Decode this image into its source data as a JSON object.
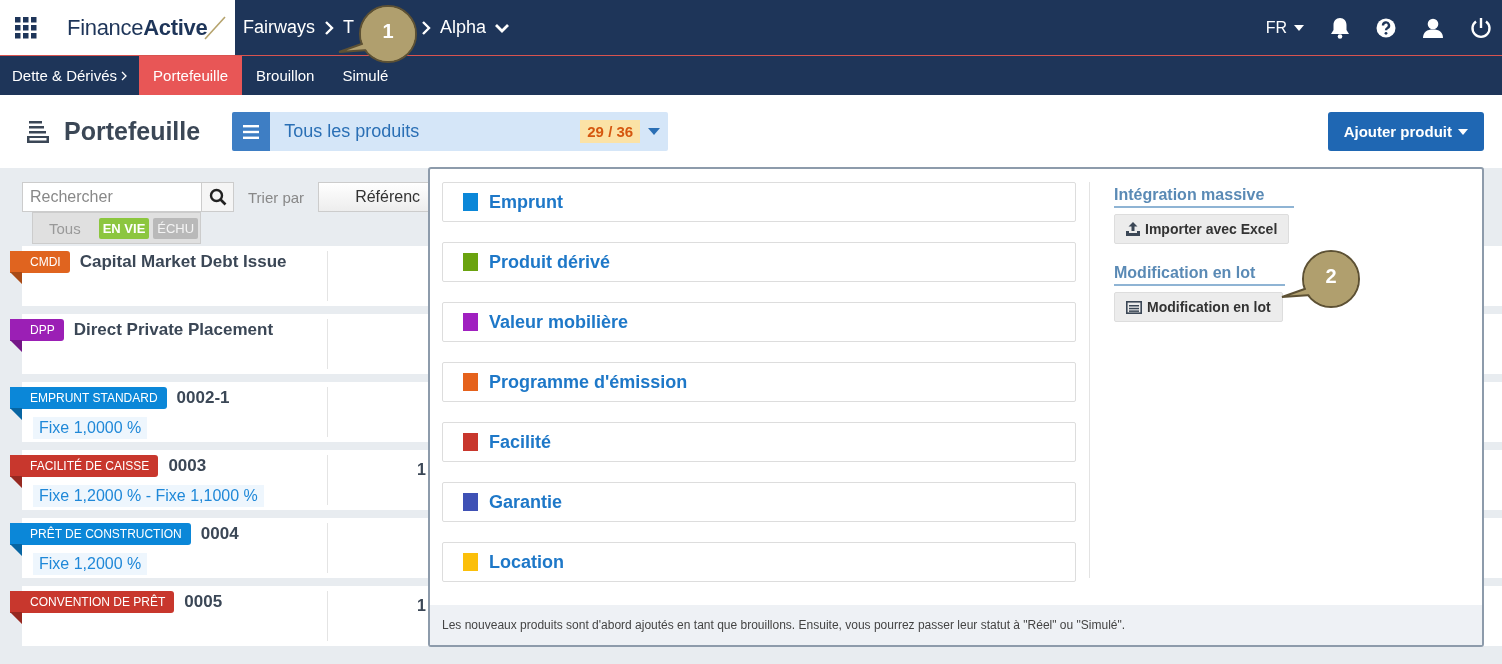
{
  "top_bar": {
    "logo": "Finance**Active**",
    "breadcrumb": [
      {
        "label": "Fairways"
      },
      {
        "label": "T"
      },
      {
        "label": "Alpha"
      }
    ],
    "language": "FR"
  },
  "sub_nav": {
    "section": "Dette & Dérivés",
    "tabs": [
      {
        "label": "Portefeuille",
        "selected": true
      },
      {
        "label": "Brouillon",
        "selected": false
      },
      {
        "label": "Simulé",
        "selected": false
      }
    ]
  },
  "header": {
    "title": "Portefeuille",
    "filter": "Tous les produits",
    "count": "29 / 36",
    "add_button": "Ajouter produit"
  },
  "toolbar": {
    "search": {
      "placeholder": "Rechercher"
    },
    "sort_label": "Trier par",
    "sort_value": "Référenc",
    "status_filter": [
      {
        "label": "Tous",
        "selected": false
      },
      {
        "label": "EN VIE",
        "selected": true,
        "color": "#8cc63f"
      },
      {
        "label": "ÉCHU",
        "selected": false,
        "color": "#b9b9b9"
      }
    ]
  },
  "rows": [
    {
      "tag": "CMDI",
      "color": "#e0641f",
      "title": "Capital Market Debt Issue"
    },
    {
      "tag": "DPP",
      "color": "#9b1fb5",
      "title": "Direct Private Placement"
    },
    {
      "tag": "EMPRUNT STANDARD",
      "color": "#0b87d8",
      "title": "0002-1",
      "rate": "Fixe 1,0000 %"
    },
    {
      "tag": "FACILITÉ DE CAISSE",
      "color": "#c8372d",
      "title": "0003",
      "rate": "Fixe 1,2000 % - Fixe 1,1000 %",
      "column_2": "1"
    },
    {
      "tag": "PRÊT DE CONSTRUCTION",
      "color": "#0b87d8",
      "title": "0004",
      "rate": "Fixe 1,2000 %"
    },
    {
      "tag": "CONVENTION DE PRÊT",
      "color": "#c8372d",
      "title": "0005",
      "column_2": "1"
    }
  ],
  "add_menu": {
    "products": [
      {
        "label": "Emprunt",
        "color": "#0b87d8"
      },
      {
        "label": "Produit dérivé",
        "color": "#6aa30f"
      },
      {
        "label": "Valeur mobilière",
        "color": "#a020c0"
      },
      {
        "label": "Programme d'émission",
        "color": "#e5621c"
      },
      {
        "label": "Facilité",
        "color": "#c8372d"
      },
      {
        "label": "Garantie",
        "color": "#3f51b5"
      },
      {
        "label": "Location",
        "color": "#fbbf0a"
      }
    ],
    "sections": [
      {
        "heading": "Intégration massive",
        "button": "Importer avec Excel",
        "kind": "upload"
      },
      {
        "heading": "Modification en lot",
        "button": "Modification en lot",
        "kind": "batch"
      }
    ],
    "note": "Les nouveaux produits sont d'abord ajoutés en tant que brouillons. Ensuite, vous pourrez passer leur statut à \"Réel\" ou \"Simulé\"."
  },
  "callouts": [
    {
      "label": "1"
    },
    {
      "label": "2"
    }
  ]
}
